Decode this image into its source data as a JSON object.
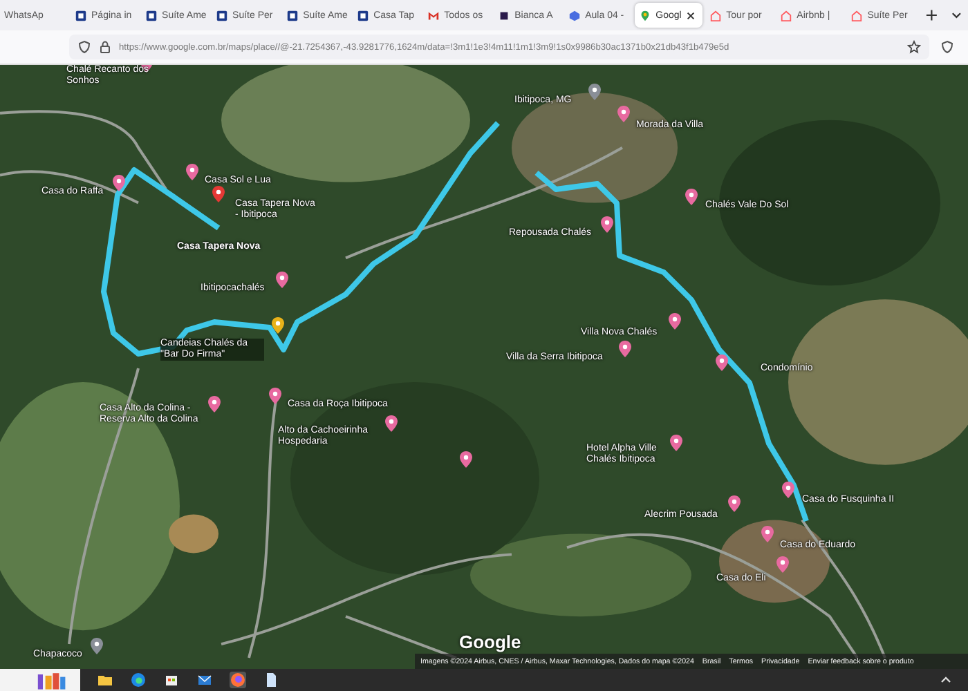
{
  "browser": {
    "tabs": [
      {
        "label": "WhatsAp",
        "selected": false
      },
      {
        "label": "Página in",
        "selected": false
      },
      {
        "label": "Suíte Ame",
        "selected": false
      },
      {
        "label": "Suíte Per",
        "selected": false
      },
      {
        "label": "Suíte Ame",
        "selected": false
      },
      {
        "label": "Casa Tap",
        "selected": false
      },
      {
        "label": "Todos os",
        "selected": false
      },
      {
        "label": "Bianca A",
        "selected": false
      },
      {
        "label": "Aula 04 -",
        "selected": false
      },
      {
        "label": "Googl",
        "selected": true
      },
      {
        "label": "Tour por",
        "selected": false
      },
      {
        "label": "Airbnb |",
        "selected": false
      },
      {
        "label": "Suíte Per",
        "selected": false
      }
    ],
    "address_bar": {
      "url": "https://www.google.com.br/maps/place//@-21.7254367,-43.9281776,1624m/data=!3m1!1e3!4m11!1m1!3m9!1s0x9986b30ac1371b0x21db43f1b479e5d"
    }
  },
  "map": {
    "places": [
      {
        "name": "Chalé Recanto dos Sonhos",
        "kind": "lodging"
      },
      {
        "name": "Casa Sol e Lua",
        "kind": "lodging"
      },
      {
        "name": "Casa do Raffa",
        "kind": "lodging"
      },
      {
        "name": "Casa Tapera Nova - Ibitipoca",
        "kind": "selected"
      },
      {
        "name": "Casa Tapera Nova",
        "kind": "label"
      },
      {
        "name": "Ibitipocachalés",
        "kind": "lodging"
      },
      {
        "name": "Candeias Chalés da \"Bar Do Firma\"",
        "kind": "bar"
      },
      {
        "name": "Ibitipoca, MG",
        "kind": "town"
      },
      {
        "name": "Morada da Villa",
        "kind": "lodging"
      },
      {
        "name": "Chalés Vale Do Sol",
        "kind": "lodging"
      },
      {
        "name": "Repousada Chalés",
        "kind": "lodging"
      },
      {
        "name": "Villa Nova Chalés",
        "kind": "lodging"
      },
      {
        "name": "Villa da Serra Ibitipoca",
        "kind": "lodging"
      },
      {
        "name": "Condomínio",
        "kind": "lodging"
      },
      {
        "name": "Casa Alto da Colina - Reserva Alto da Colina",
        "kind": "lodging"
      },
      {
        "name": "Casa da Roça Ibitipoca",
        "kind": "lodging"
      },
      {
        "name": "Alto da Cachoeirinha Hospedaria",
        "kind": "lodging"
      },
      {
        "kind": "lodging"
      },
      {
        "name": "Hotel Alpha Ville Chalés Ibitipoca",
        "kind": "lodging"
      },
      {
        "name": "Casa do Fusquinha II",
        "kind": "lodging"
      },
      {
        "name": "Alecrim Pousada",
        "kind": "lodging"
      },
      {
        "name": "Casa do Eduardo",
        "kind": "lodging"
      },
      {
        "name": "Casa do Eli",
        "kind": "lodging"
      },
      {
        "name": "Chapacoco",
        "kind": "town"
      }
    ],
    "logo": "Google",
    "attribution": "Imagens ©2024 Airbus, CNES / Airbus, Maxar Technologies, Dados do mapa ©2024",
    "footer_links": [
      "Brasil",
      "Termos",
      "Privacidade",
      "Enviar feedback sobre o produto"
    ]
  }
}
